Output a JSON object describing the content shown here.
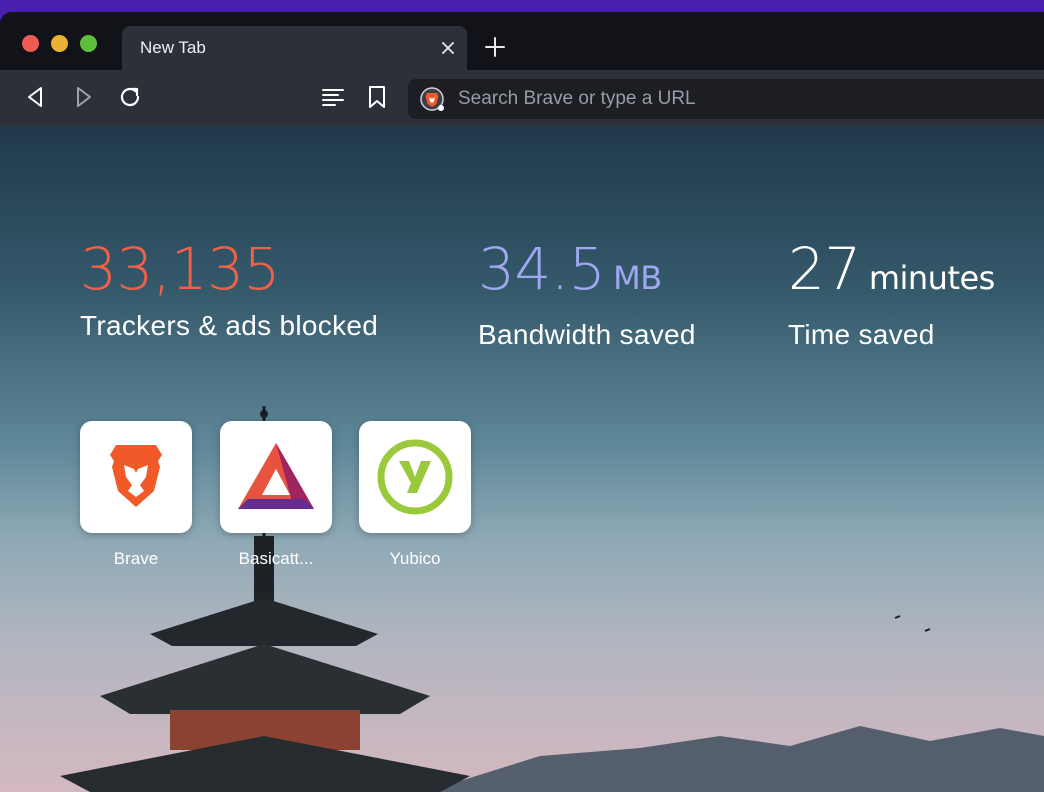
{
  "tab": {
    "title": "New Tab",
    "close_icon": "close-icon"
  },
  "toolbar": {
    "back_icon": "back-icon",
    "forward_icon": "forward-icon",
    "reload_icon": "reload-icon",
    "reader_icon": "reader-mode-icon",
    "bookmark_icon": "bookmark-icon",
    "search_placeholder": "Search Brave or type a URL"
  },
  "stats": {
    "trackers": {
      "value": "33,135",
      "unit": "",
      "label": "Trackers & ads blocked"
    },
    "bandwidth": {
      "value": "34.5",
      "unit": "MB",
      "label": "Bandwidth saved"
    },
    "time": {
      "value": "27",
      "unit": "minutes",
      "label": "Time saved"
    }
  },
  "top_sites": [
    {
      "label": "Brave",
      "icon": "brave-lion-icon"
    },
    {
      "label": "Basicatt...",
      "icon": "bat-triangle-icon"
    },
    {
      "label": "Yubico",
      "icon": "yubico-icon"
    }
  ],
  "colors": {
    "trackers": "#f26145",
    "bandwidth": "#a1a8f2",
    "time": "#ffffff",
    "window_frame": "#5b2bc4"
  }
}
